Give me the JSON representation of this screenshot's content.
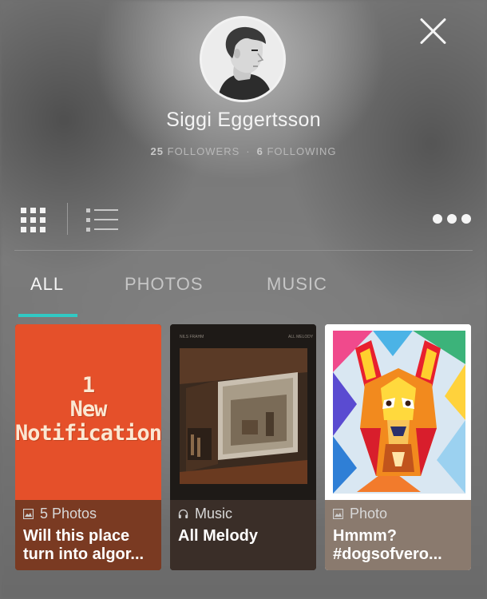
{
  "profile": {
    "name": "Siggi Eggertsson",
    "followers_count": "25",
    "followers_label": "FOLLOWERS",
    "following_count": "6",
    "following_label": "FOLLOWING"
  },
  "toolbar": {
    "icons": [
      "close-icon",
      "grid-view-icon",
      "list-view-icon",
      "more-options-icon"
    ]
  },
  "tabs": [
    {
      "label": "ALL",
      "active": true
    },
    {
      "label": "PHOTOS",
      "active": false
    },
    {
      "label": "MUSIC",
      "active": false
    }
  ],
  "accent_color": "#31c9c4",
  "cards": [
    {
      "type_icon": "image-icon",
      "type_label": "5 Photos",
      "title": "Will this place\nturn into algor...",
      "cover_text": "1\nNew\nNotification",
      "cover_color": "#e5502a"
    },
    {
      "type_icon": "headphones-icon",
      "type_label": "Music",
      "title": "All Melody",
      "cover_header_left": "NILS FRAHM",
      "cover_header_right": "ALL MELODY"
    },
    {
      "type_icon": "image-icon",
      "type_label": "Photo",
      "title": "Hmmm?\n#dogsofvero..."
    }
  ]
}
